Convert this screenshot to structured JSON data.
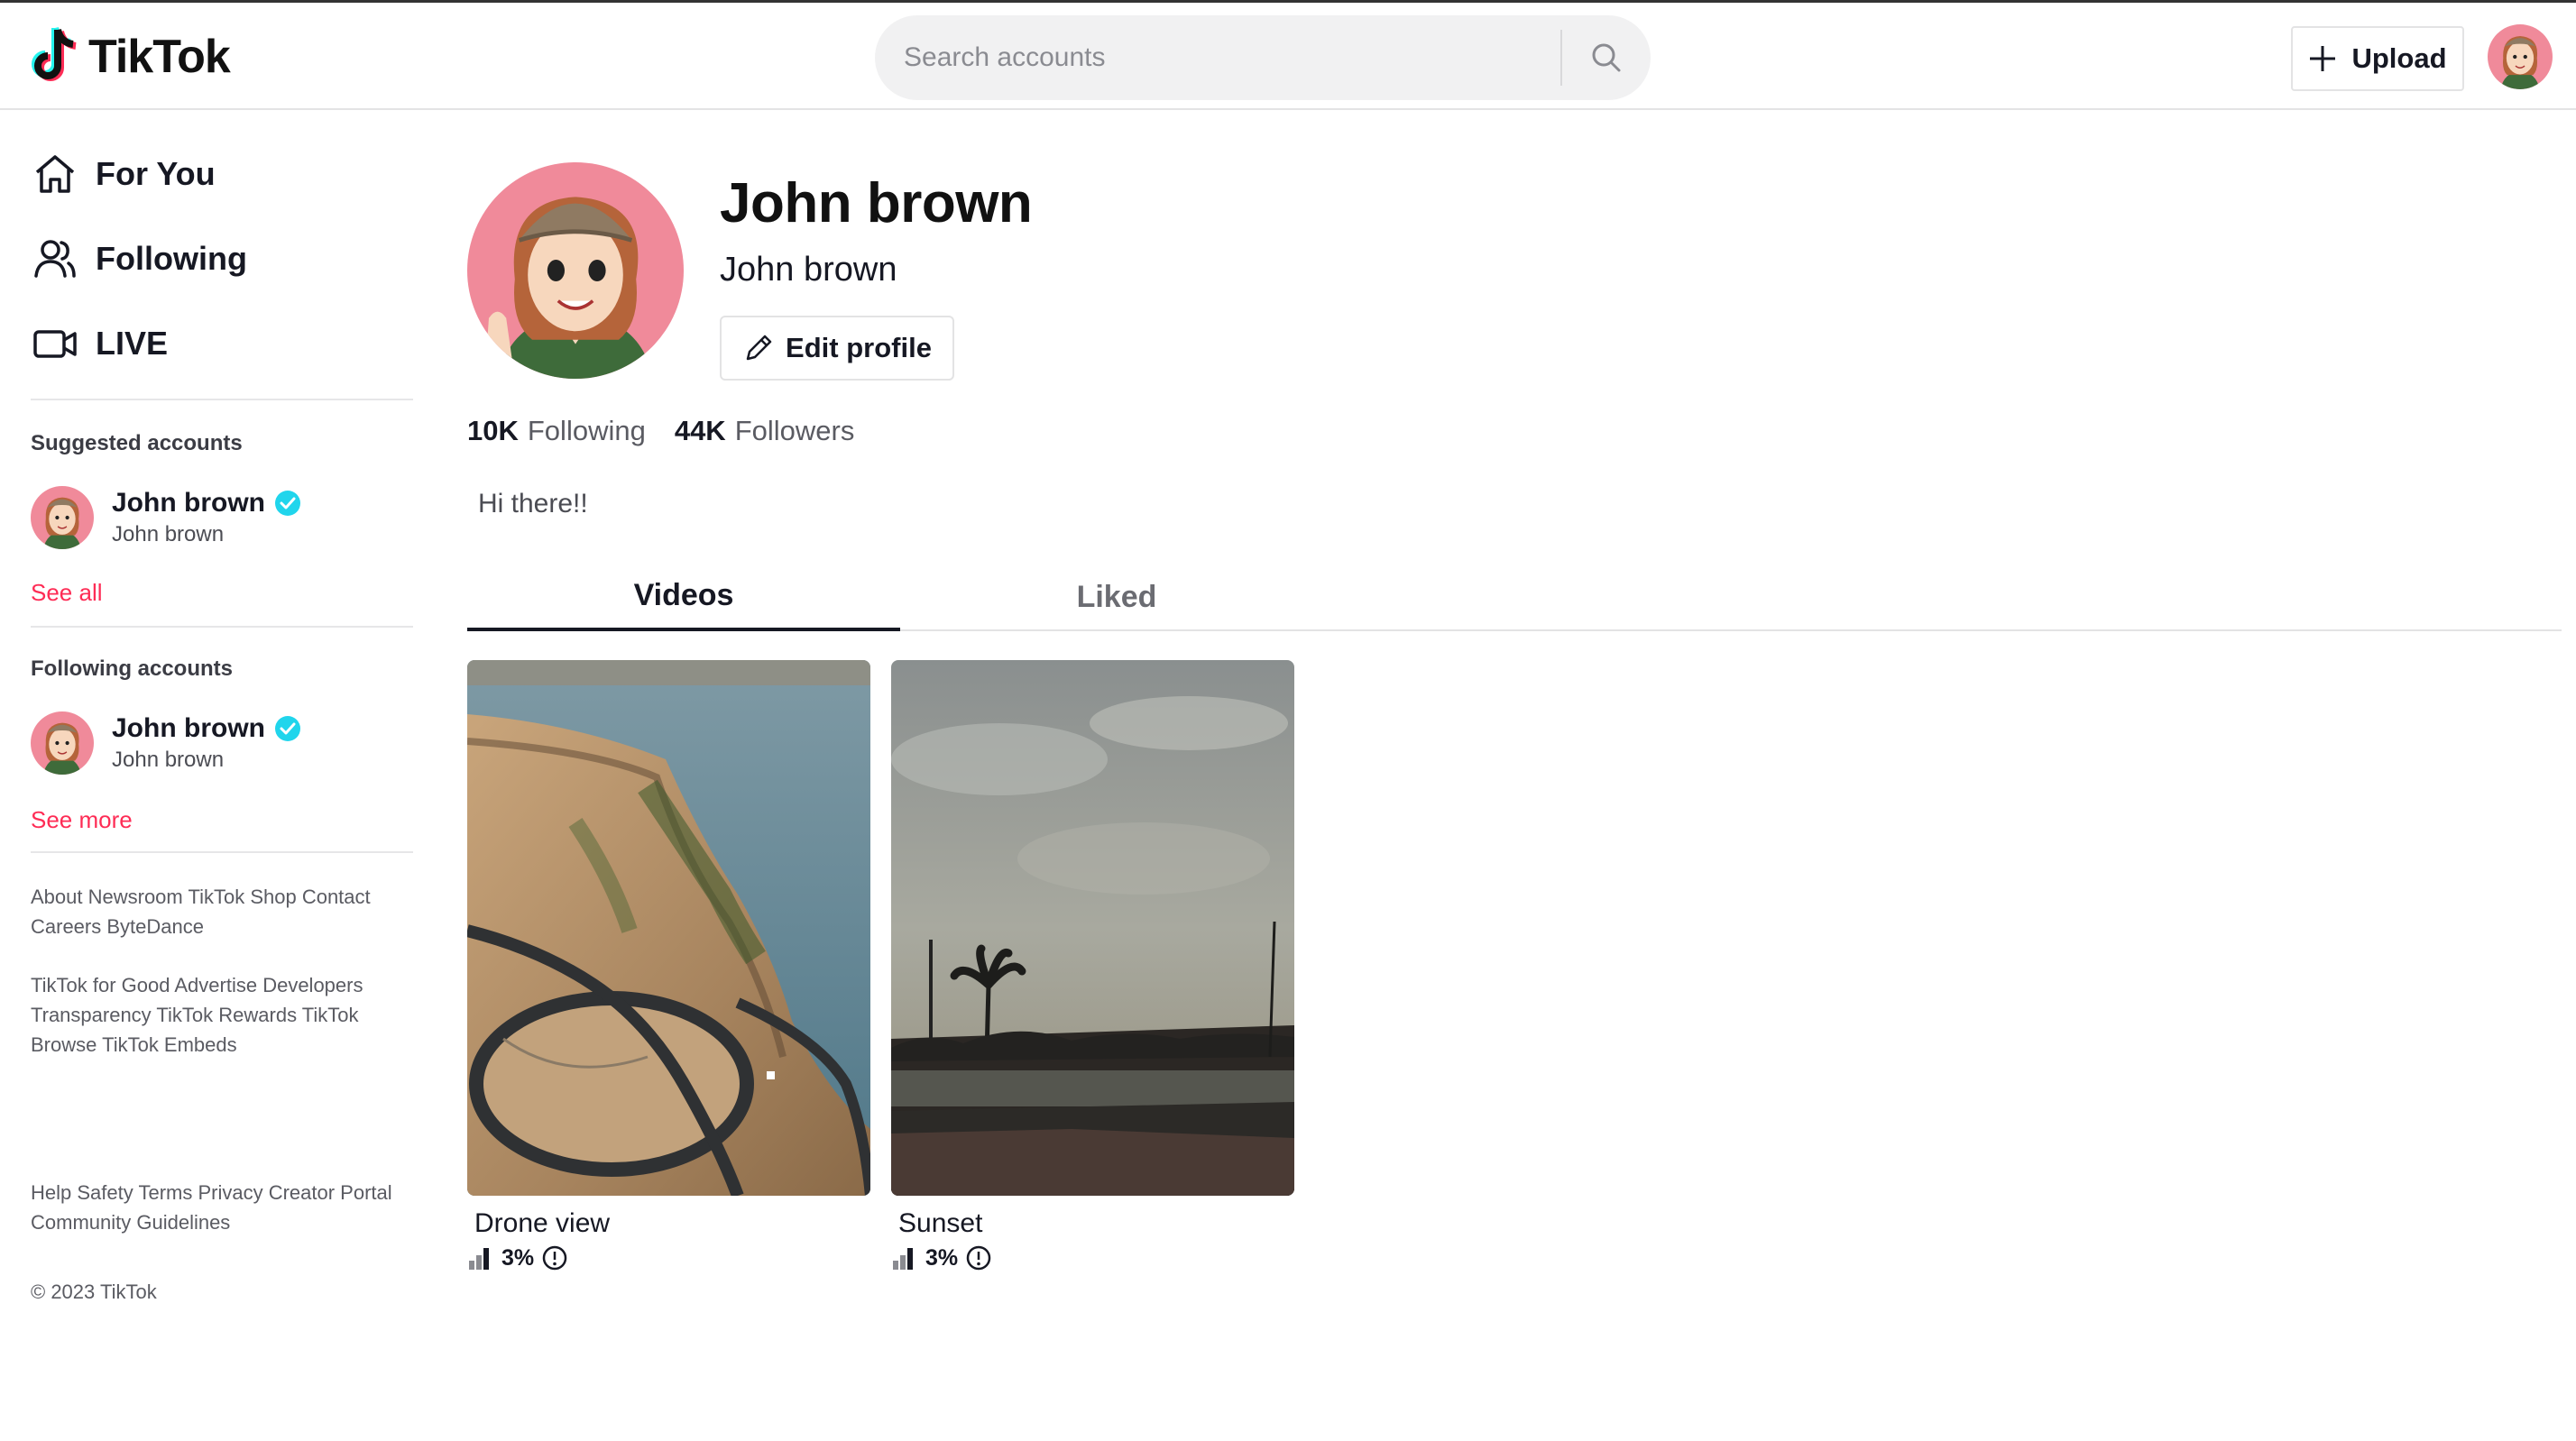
{
  "header": {
    "logo_text": "TikTok",
    "search": {
      "placeholder": "Search accounts"
    },
    "upload_label": "Upload"
  },
  "sidebar": {
    "nav": [
      {
        "label": "For You",
        "icon": "home-icon"
      },
      {
        "label": "Following",
        "icon": "users-icon"
      },
      {
        "label": "LIVE",
        "icon": "video-camera-icon"
      }
    ],
    "suggested": {
      "title": "Suggested accounts",
      "accounts": [
        {
          "name": "John brown",
          "handle": "John brown",
          "verified": true
        }
      ],
      "link": "See all"
    },
    "following": {
      "title": "Following accounts",
      "accounts": [
        {
          "name": "John brown",
          "handle": "John brown",
          "verified": true
        }
      ],
      "link": "See more"
    },
    "footer": {
      "group1": [
        "About",
        "Newsroom",
        "TikTok Shop",
        "Contact",
        "Careers",
        "ByteDance"
      ],
      "group2": [
        "TikTok for Good",
        "Advertise",
        "Developers",
        "Transparency",
        "TikTok Rewards",
        "TikTok Browse",
        "TikTok Embeds"
      ],
      "group3": [
        "Help",
        "Safety",
        "Terms",
        "Privacy",
        "Creator Portal",
        "Community Guidelines"
      ],
      "copyright": "© 2023 TikTok"
    }
  },
  "profile": {
    "name": "John brown",
    "handle": "John brown",
    "edit_label": "Edit profile",
    "following_count": "10K",
    "following_label": "Following",
    "followers_count": "44K",
    "followers_label": "Followers",
    "bio": "Hi there!!"
  },
  "tabs": [
    {
      "label": "Videos",
      "active": true
    },
    {
      "label": "Liked",
      "active": false
    }
  ],
  "videos": [
    {
      "title": "Drone view",
      "stat": "3%"
    },
    {
      "title": "Sunset",
      "stat": "3%"
    }
  ],
  "colors": {
    "accent": "#fe2c55",
    "verified": "#20d5ec"
  }
}
